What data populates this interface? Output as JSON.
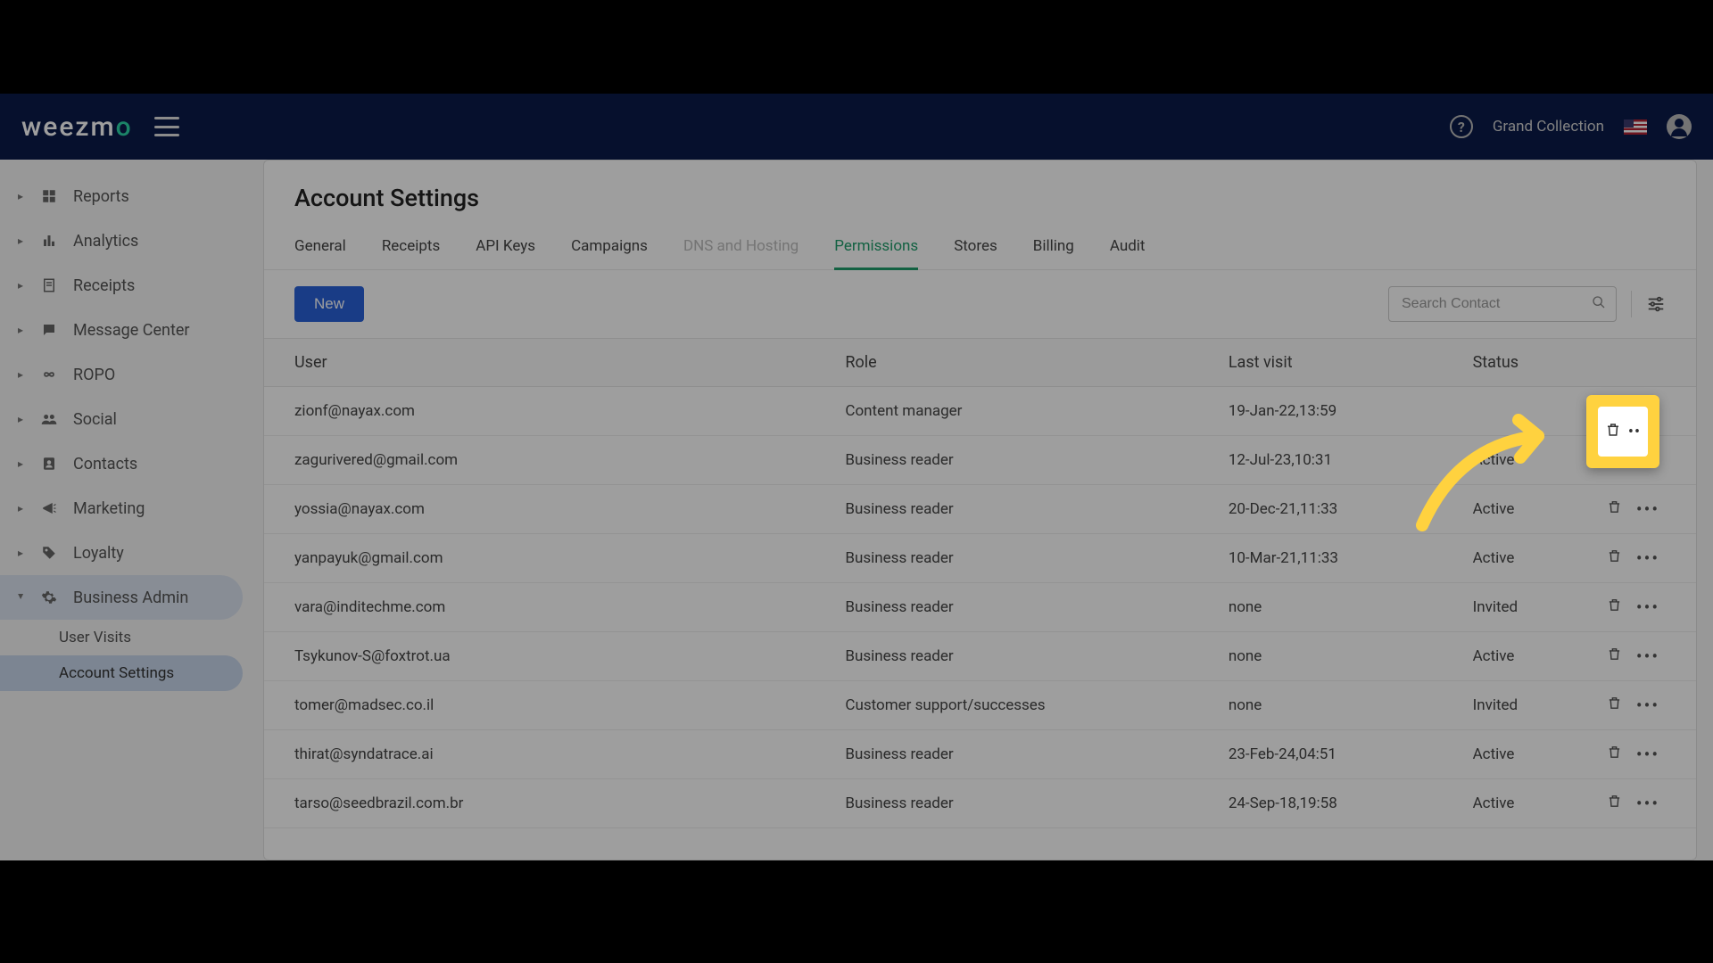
{
  "header": {
    "brand_pre": "weezm",
    "brand_accent": "o",
    "account_name": "Grand Collection"
  },
  "sidebar": {
    "items": [
      {
        "label": "Reports",
        "icon": "dashboard"
      },
      {
        "label": "Analytics",
        "icon": "bar-chart"
      },
      {
        "label": "Receipts",
        "icon": "receipt"
      },
      {
        "label": "Message Center",
        "icon": "chat"
      },
      {
        "label": "ROPO",
        "icon": "infinity"
      },
      {
        "label": "Social",
        "icon": "group"
      },
      {
        "label": "Contacts",
        "icon": "contacts"
      },
      {
        "label": "Marketing",
        "icon": "megaphone"
      },
      {
        "label": "Loyalty",
        "icon": "tag"
      },
      {
        "label": "Business Admin",
        "icon": "gear",
        "expanded": true
      }
    ],
    "subitems": [
      {
        "label": "User Visits"
      },
      {
        "label": "Account Settings",
        "active": true
      }
    ]
  },
  "page": {
    "title": "Account Settings",
    "tabs": [
      {
        "label": "General"
      },
      {
        "label": "Receipts"
      },
      {
        "label": "API Keys"
      },
      {
        "label": "Campaigns"
      },
      {
        "label": "DNS and Hosting",
        "disabled": true
      },
      {
        "label": "Permissions",
        "active": true
      },
      {
        "label": "Stores"
      },
      {
        "label": "Billing"
      },
      {
        "label": "Audit"
      }
    ],
    "new_button": "New",
    "search_placeholder": "Search Contact"
  },
  "table": {
    "headers": {
      "user": "User",
      "role": "Role",
      "last_visit": "Last visit",
      "status": "Status"
    },
    "rows": [
      {
        "user": "zionf@nayax.com",
        "role": "Content manager",
        "last_visit": "19-Jan-22,13:59",
        "status": ""
      },
      {
        "user": "zagurivered@gmail.com",
        "role": "Business reader",
        "last_visit": "12-Jul-23,10:31",
        "status": "Active"
      },
      {
        "user": "yossia@nayax.com",
        "role": "Business reader",
        "last_visit": "20-Dec-21,11:33",
        "status": "Active"
      },
      {
        "user": "yanpayuk@gmail.com",
        "role": "Business reader",
        "last_visit": "10-Mar-21,11:33",
        "status": "Active"
      },
      {
        "user": "vara@inditechme.com",
        "role": "Business reader",
        "last_visit": "none",
        "status": "Invited"
      },
      {
        "user": "Tsykunov-S@foxtrot.ua",
        "role": "Business reader",
        "last_visit": "none",
        "status": "Active"
      },
      {
        "user": "tomer@madsec.co.il",
        "role": "Customer support/successes",
        "last_visit": "none",
        "status": "Invited"
      },
      {
        "user": "thirat@syndatrace.ai",
        "role": "Business reader",
        "last_visit": "23-Feb-24,04:51",
        "status": "Active"
      },
      {
        "user": "tarso@seedbrazil.com.br",
        "role": "Business reader",
        "last_visit": "24-Sep-18,19:58",
        "status": "Active"
      }
    ]
  },
  "colors": {
    "brand_bg": "#0a1a4a",
    "accent": "#2dd4a7",
    "primary_btn": "#2962d9",
    "active_tab": "#1f9d6b",
    "status_active": "#2e8b57",
    "status_invited": "#5b7bd0",
    "highlight": "#ffd23f"
  }
}
